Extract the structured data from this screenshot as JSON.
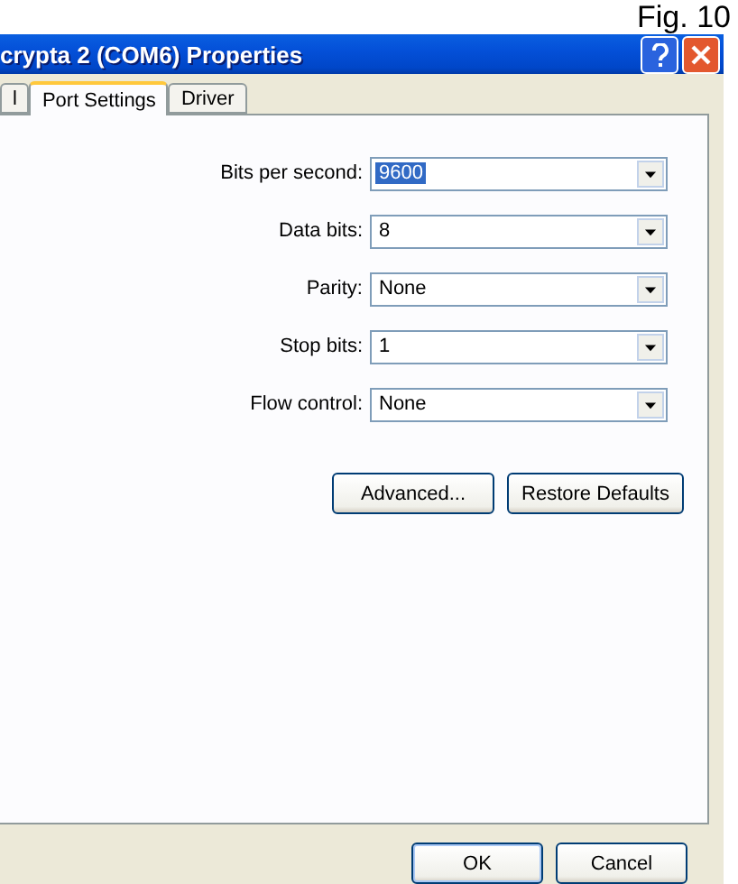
{
  "figure_label": "Fig. 10",
  "window": {
    "title": "crypta 2 (COM6) Properties"
  },
  "tabs": [
    {
      "label": "l",
      "selected": false
    },
    {
      "label": "Port Settings",
      "selected": true
    },
    {
      "label": "Driver",
      "selected": false
    }
  ],
  "settings": [
    {
      "label": "Bits per second:",
      "value": "9600",
      "focused": true
    },
    {
      "label": "Data bits:",
      "value": "8",
      "focused": false
    },
    {
      "label": "Parity:",
      "value": "None",
      "focused": false
    },
    {
      "label": "Stop bits:",
      "value": "1",
      "focused": false
    },
    {
      "label": "Flow control:",
      "value": "None",
      "focused": false
    }
  ],
  "panel_buttons": [
    "Advanced...",
    "Restore Defaults"
  ],
  "dialog_buttons": [
    {
      "label": "OK",
      "default": true
    },
    {
      "label": "Cancel",
      "default": false
    }
  ]
}
